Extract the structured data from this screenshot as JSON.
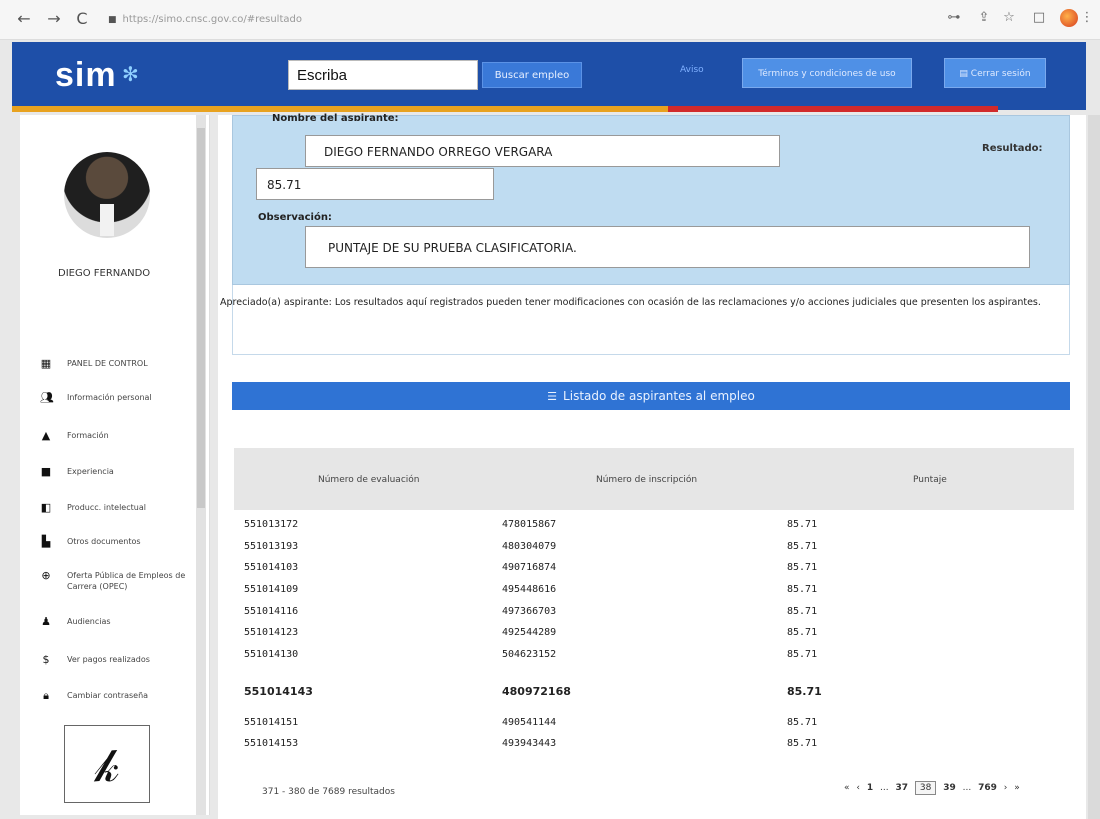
{
  "browser": {
    "url": "https://simo.cnsc.gov.co/#resultado"
  },
  "header": {
    "logo_text": "sim",
    "search_value": "Escriba",
    "search_button": "Buscar empleo",
    "link_label": "Aviso",
    "terms_button": "Términos y condiciones de uso",
    "logout_button": "Cerrar sesión"
  },
  "sidebar": {
    "user_name": "DIEGO FERNANDO",
    "items": [
      {
        "label": "PANEL DE CONTROL",
        "icon": "grid-icon"
      },
      {
        "label": "Información personal",
        "icon": "users-icon"
      },
      {
        "label": "Formación",
        "icon": "graduation-icon"
      },
      {
        "label": "Experiencia",
        "icon": "briefcase-icon"
      },
      {
        "label": "Producc. intelectual",
        "icon": "book-icon"
      },
      {
        "label": "Otros documentos",
        "icon": "document-icon"
      },
      {
        "label": "Oferta Pública de Empleos de Carrera (OPEC)",
        "icon": "globe-icon"
      },
      {
        "label": "Audiencias",
        "icon": "audience-icon"
      },
      {
        "label": "Ver pagos realizados",
        "icon": "dollar-icon"
      },
      {
        "label": "Cambiar contraseña",
        "icon": "lock-icon"
      }
    ]
  },
  "result": {
    "name_label": "Nombre del aspirante:",
    "name_value": "DIEGO FERNANDO ORREGO VERGARA",
    "result_label": "Resultado:",
    "score_value": "85.71",
    "observation_label": "Observación:",
    "observation_value": "PUNTAJE DE SU PRUEBA CLASIFICATORIA.",
    "notice": "Apreciado(a) aspirante: Los resultados aquí registrados pueden tener modificaciones con ocasión de las reclamaciones y/o acciones judiciales que presenten los aspirantes."
  },
  "list": {
    "title": "Listado de aspirantes al empleo",
    "columns": [
      "Número de evaluación",
      "Número de inscripción",
      "Puntaje"
    ],
    "rows": [
      {
        "eval": "551013172",
        "insc": "478015867",
        "score": "85.71",
        "highlight": false
      },
      {
        "eval": "551013193",
        "insc": "480304079",
        "score": "85.71",
        "highlight": false
      },
      {
        "eval": "551014103",
        "insc": "490716874",
        "score": "85.71",
        "highlight": false
      },
      {
        "eval": "551014109",
        "insc": "495448616",
        "score": "85.71",
        "highlight": false
      },
      {
        "eval": "551014116",
        "insc": "497366703",
        "score": "85.71",
        "highlight": false
      },
      {
        "eval": "551014123",
        "insc": "492544289",
        "score": "85.71",
        "highlight": false
      },
      {
        "eval": "551014130",
        "insc": "504623152",
        "score": "85.71",
        "highlight": false
      },
      {
        "eval": "551014143",
        "insc": "480972168",
        "score": "85.71",
        "highlight": true
      },
      {
        "eval": "551014151",
        "insc": "490541144",
        "score": "85.71",
        "highlight": false
      },
      {
        "eval": "551014153",
        "insc": "493943443",
        "score": "85.71",
        "highlight": false
      }
    ],
    "footer_count": "371 - 380 de 7689 resultados",
    "pager": {
      "first": "«",
      "prev": "‹",
      "page_first": "1",
      "ellipsis1": "...",
      "page_prev": "37",
      "page_current": "38",
      "page_next": "39",
      "ellipsis2": "...",
      "page_last": "769",
      "next": "›",
      "last": "»"
    }
  }
}
